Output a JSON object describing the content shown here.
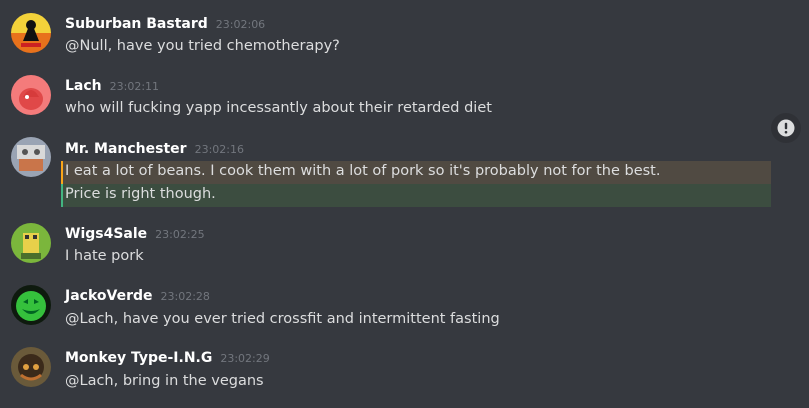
{
  "messages": [
    {
      "author": "Suburban Bastard",
      "time": "23:02:06",
      "lines": [
        "@Null, have you tried chemotherapy?"
      ]
    },
    {
      "author": "Lach",
      "time": "23:02:11",
      "lines": [
        "who will fucking yapp incessantly about their retarded diet"
      ]
    },
    {
      "author": "Mr. Manchester",
      "time": "23:02:16",
      "lines": [
        "I eat a lot of beans. I cook them with a lot of pork so it's probably not for the best.",
        "Price is right though."
      ]
    },
    {
      "author": "Wigs4Sale",
      "time": "23:02:25",
      "lines": [
        "I hate pork"
      ]
    },
    {
      "author": "JackoVerde",
      "time": "23:02:28",
      "lines": [
        "@Lach, have you ever tried crossfit and intermittent fasting"
      ]
    },
    {
      "author": "Monkey Type-I.N.G",
      "time": "23:02:29",
      "lines": [
        "@Lach, bring in the vegans"
      ]
    }
  ],
  "colors": {
    "background": "#36393f",
    "highlight_mention": "#504a42",
    "highlight_reply": "#3c4d40"
  },
  "icons": {
    "side_button": "alert-icon"
  }
}
